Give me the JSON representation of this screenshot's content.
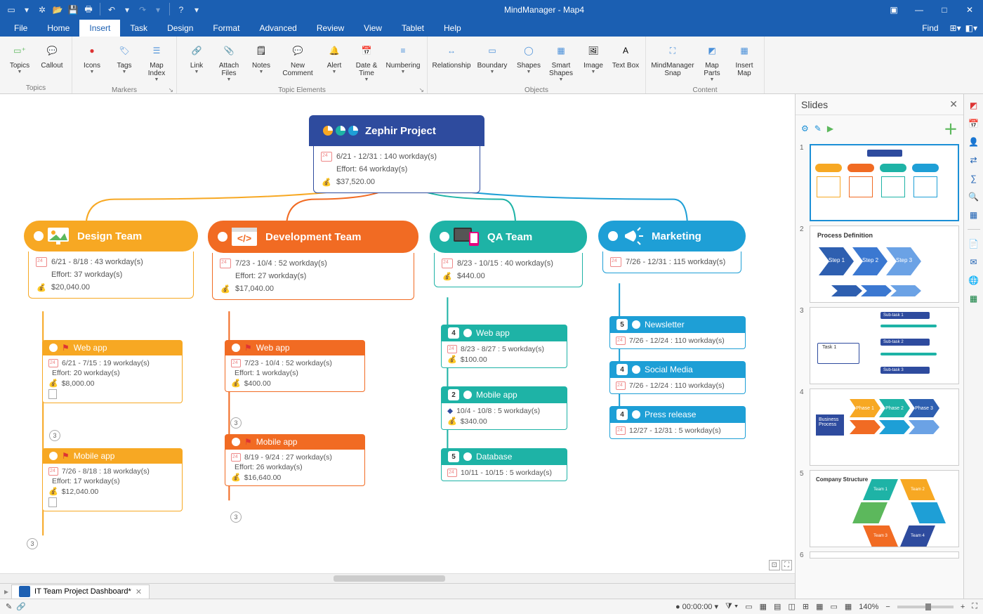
{
  "app": {
    "title": "MindManager - Map4",
    "find": "Find"
  },
  "menu": [
    "File",
    "Home",
    "Insert",
    "Task",
    "Design",
    "Format",
    "Advanced",
    "Review",
    "View",
    "Tablet",
    "Help"
  ],
  "menu_active": 2,
  "ribbon_groups": [
    {
      "label": "Topics",
      "items": [
        {
          "name": "topics",
          "label": "Topics",
          "dd": true
        },
        {
          "name": "callout",
          "label": "Callout"
        }
      ]
    },
    {
      "label": "Markers",
      "items": [
        {
          "name": "icons",
          "label": "Icons",
          "dd": true
        },
        {
          "name": "tags",
          "label": "Tags",
          "dd": true
        },
        {
          "name": "mapindex",
          "label": "Map Index",
          "dd": true
        }
      ],
      "dlg": true
    },
    {
      "label": "Topic Elements",
      "items": [
        {
          "name": "link",
          "label": "Link",
          "dd": true
        },
        {
          "name": "attachfiles",
          "label": "Attach Files",
          "dd": true
        },
        {
          "name": "notes",
          "label": "Notes",
          "dd": true
        },
        {
          "name": "newcomment",
          "label": "New Comment"
        },
        {
          "name": "alert",
          "label": "Alert",
          "dd": true
        },
        {
          "name": "datetime",
          "label": "Date & Time",
          "dd": true
        },
        {
          "name": "numbering",
          "label": "Numbering",
          "dd": true
        }
      ],
      "dlg": true
    },
    {
      "label": "Objects",
      "items": [
        {
          "name": "relationship",
          "label": "Relationship"
        },
        {
          "name": "boundary",
          "label": "Boundary",
          "dd": true
        },
        {
          "name": "shapes",
          "label": "Shapes",
          "dd": true
        },
        {
          "name": "smartshapes",
          "label": "Smart Shapes",
          "dd": true
        },
        {
          "name": "image",
          "label": "Image",
          "dd": true
        },
        {
          "name": "textbox",
          "label": "Text Box"
        }
      ]
    },
    {
      "label": "Content",
      "items": [
        {
          "name": "mmsnap",
          "label": "MindManager Snap"
        },
        {
          "name": "mapparts",
          "label": "Map Parts",
          "dd": true
        },
        {
          "name": "insertmap",
          "label": "Insert Map"
        }
      ]
    }
  ],
  "map": {
    "root": {
      "title": "Zephir Project",
      "dates": "6/21 - 12/31 : 140 workday(s)",
      "effort": "Effort: 64 workday(s)",
      "cost": "$37,520.00"
    },
    "branches": [
      {
        "color": "orange",
        "title": "Design Team",
        "dates": "6/21 - 8/18 : 43 workday(s)",
        "effort": "Effort: 37 workday(s)",
        "cost": "$20,040.00",
        "children": [
          {
            "title": "Web app",
            "dates": "6/21 - 7/15 : 19 workday(s)",
            "effort": "Effort: 20 workday(s)",
            "cost": "$8,000.00",
            "note": true,
            "count": "3"
          },
          {
            "title": "Mobile app",
            "dates": "7/26 - 8/18 : 18 workday(s)",
            "effort": "Effort: 17 workday(s)",
            "cost": "$12,040.00",
            "note": true,
            "count": "3"
          }
        ]
      },
      {
        "color": "dorange",
        "title": "Development Team",
        "dates": "7/23 - 10/4 : 52 workday(s)",
        "effort": "Effort: 27 workday(s)",
        "cost": "$17,040.00",
        "children": [
          {
            "title": "Web app",
            "dates": "7/23 - 10/4 : 52 workday(s)",
            "effort": "Effort: 1 workday(s)",
            "cost": "$400.00",
            "count": "3"
          },
          {
            "title": "Mobile app",
            "dates": "8/19 - 9/24 : 27 workday(s)",
            "effort": "Effort: 26 workday(s)",
            "cost": "$16,640.00",
            "count": "3"
          }
        ]
      },
      {
        "color": "teal",
        "title": "QA Team",
        "dates": "8/23 - 10/15 : 40 workday(s)",
        "cost": "$440.00",
        "children": [
          {
            "badge": "4",
            "title": "Web app",
            "dates": "8/23 - 8/27 : 5 workday(s)",
            "cost": "$100.00"
          },
          {
            "badge": "2",
            "title": "Mobile app",
            "dates": "10/4 - 10/8 : 5 workday(s)",
            "cost": "$340.00",
            "diamond": true
          },
          {
            "badge": "5",
            "title": "Database",
            "dates": "10/11 - 10/15 : 5 workday(s)"
          }
        ]
      },
      {
        "color": "blue",
        "title": "Marketing",
        "dates": "7/26 - 12/31 : 115 workday(s)",
        "children": [
          {
            "badge": "5",
            "title": "Newsletter",
            "dates": "7/26 - 12/24 : 110 workday(s)"
          },
          {
            "badge": "4",
            "title": "Social Media",
            "dates": "7/26 - 12/24 : 110 workday(s)"
          },
          {
            "badge": "4",
            "title": "Press release",
            "dates": "12/27 - 12/31 : 5 workday(s)"
          }
        ]
      }
    ]
  },
  "slides": {
    "title": "Slides",
    "items": [
      {
        "n": "1"
      },
      {
        "n": "2",
        "title": "Process Definition",
        "steps": [
          "Step 1",
          "Step 2",
          "Step 3"
        ]
      },
      {
        "n": "3",
        "task": "Task 1",
        "subs": [
          "Sub-task 1",
          "Sub-task 2",
          "Sub-task 3"
        ]
      },
      {
        "n": "4",
        "bp": "Business Process",
        "phases": [
          "Phase 1",
          "Phase 2",
          "Phase 3"
        ]
      },
      {
        "n": "5",
        "cs": "Company Structure",
        "teams": [
          "Team 1",
          "Team 2",
          "Team 3",
          "Team 4"
        ]
      },
      {
        "n": "6"
      }
    ]
  },
  "tab": {
    "name": "IT Team Project Dashboard*"
  },
  "status": {
    "timer": "00:00:00",
    "zoom": "140%"
  }
}
